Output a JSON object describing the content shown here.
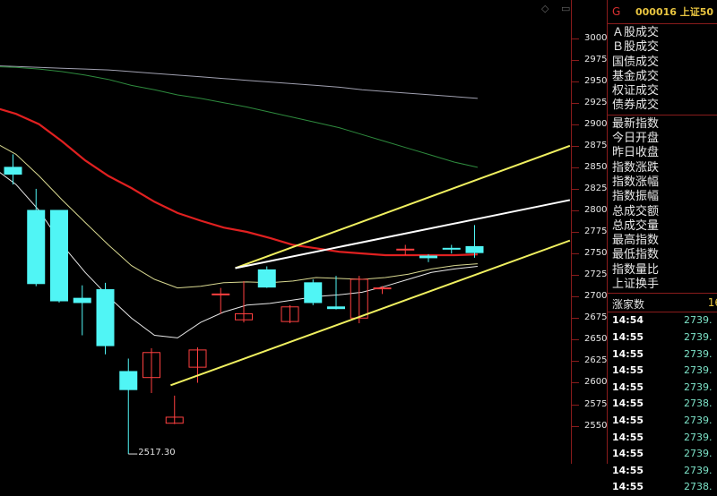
{
  "panel": {
    "market_letter": "G",
    "code_title": "000016 上证50",
    "trade_labels": [
      "Ａ股成交",
      "Ｂ股成交",
      "国债成交",
      "基金成交",
      "权证成交",
      "债券成交"
    ],
    "index_labels": [
      "最新指数",
      "今日开盘",
      "昨日收盘",
      "指数涨跌",
      "指数涨幅",
      "指数振幅",
      "总成交额",
      "总成交量",
      "最高指数",
      "最低指数",
      "指数量比",
      "上证换手"
    ],
    "rise_label": "涨家数",
    "rise_value": "16",
    "ticks": [
      {
        "time": "14:54",
        "price": "2739."
      },
      {
        "time": "14:55",
        "price": "2739."
      },
      {
        "time": "14:55",
        "price": "2739."
      },
      {
        "time": "14:55",
        "price": "2739."
      },
      {
        "time": "14:55",
        "price": "2739."
      },
      {
        "time": "14:55",
        "price": "2738."
      },
      {
        "time": "14:55",
        "price": "2739."
      },
      {
        "time": "14:55",
        "price": "2739."
      },
      {
        "time": "14:55",
        "price": "2739."
      },
      {
        "time": "14:55",
        "price": "2739."
      },
      {
        "time": "14:55",
        "price": "2738."
      }
    ]
  },
  "icons": [
    "dropdown-icon",
    "window-icon"
  ],
  "chart_data": {
    "type": "candlestick",
    "ylim": [
      2530,
      3040
    ],
    "yticks": [
      3000,
      2975,
      2950,
      2925,
      2900,
      2875,
      2850,
      2825,
      2800,
      2775,
      2750,
      2725,
      2700,
      2675,
      2650,
      2625,
      2600,
      2575,
      2550
    ],
    "low_label": "2517.30",
    "colors": {
      "up": "#ff4040",
      "down": "#50f5f5",
      "ma_white": "#e8e8e8",
      "ma_yellow": "#d8d890",
      "ma_red": "#e02020",
      "ma_green": "#2e8b3e",
      "ma_gray": "#a0a0b0",
      "trend_yellow": "#f0f060",
      "trend_white": "#ffffff",
      "axis_red": "#8a1c1c"
    },
    "candles": [
      {
        "open": 2850,
        "high": 2865,
        "low": 2830,
        "close": 2842
      },
      {
        "open": 2800,
        "high": 2825,
        "low": 2712,
        "close": 2715
      },
      {
        "open": 2800,
        "high": 2800,
        "low": 2693,
        "close": 2695
      },
      {
        "open": 2698,
        "high": 2713,
        "low": 2655,
        "close": 2693
      },
      {
        "open": 2708,
        "high": 2716,
        "low": 2633,
        "close": 2643
      },
      {
        "open": 2613,
        "high": 2628,
        "low": 2517.3,
        "close": 2592
      },
      {
        "open": 2606,
        "high": 2640,
        "low": 2588,
        "close": 2635
      },
      {
        "open": 2553,
        "high": 2585,
        "low": 2552,
        "close": 2560
      },
      {
        "open": 2618,
        "high": 2641,
        "low": 2600,
        "close": 2638
      },
      {
        "open": 2703,
        "high": 2710,
        "low": 2680,
        "close": 2703
      },
      {
        "open": 2673,
        "high": 2718,
        "low": 2670,
        "close": 2680
      },
      {
        "open": 2731,
        "high": 2735,
        "low": 2710,
        "close": 2711
      },
      {
        "open": 2671,
        "high": 2690,
        "low": 2669,
        "close": 2688
      },
      {
        "open": 2716,
        "high": 2720,
        "low": 2690,
        "close": 2693
      },
      {
        "open": 2688,
        "high": 2724,
        "low": 2685,
        "close": 2686
      },
      {
        "open": 2675,
        "high": 2724,
        "low": 2669,
        "close": 2720
      },
      {
        "open": 2709,
        "high": 2712,
        "low": 2703,
        "close": 2710
      },
      {
        "open": 2755,
        "high": 2760,
        "low": 2748,
        "close": 2755
      },
      {
        "open": 2747,
        "high": 2749,
        "low": 2740,
        "close": 2745
      },
      {
        "open": 2756,
        "high": 2760,
        "low": 2750,
        "close": 2755
      },
      {
        "open": 2758,
        "high": 2783,
        "low": 2745,
        "close": 2751
      }
    ],
    "moving_averages": [
      {
        "id": "ma-gray",
        "values": [
          2968,
          2967,
          2966,
          2965,
          2964,
          2963,
          2961,
          2959,
          2957,
          2955,
          2953,
          2951,
          2949,
          2947,
          2945,
          2943,
          2940,
          2938,
          2936,
          2934,
          2932,
          2930
        ]
      },
      {
        "id": "ma-green",
        "values": [
          2967,
          2966,
          2964,
          2961,
          2957,
          2952,
          2945,
          2940,
          2934,
          2930,
          2925,
          2920,
          2914,
          2908,
          2902,
          2896,
          2888,
          2880,
          2872,
          2864,
          2856,
          2850
        ]
      },
      {
        "id": "ma-red",
        "values": [
          2920,
          2912,
          2900,
          2880,
          2858,
          2840,
          2826,
          2810,
          2797,
          2788,
          2780,
          2775,
          2768,
          2760,
          2756,
          2752,
          2750,
          2748,
          2748,
          2748,
          2748,
          2749
        ]
      },
      {
        "id": "ma-yellow",
        "values": [
          2880,
          2865,
          2840,
          2812,
          2786,
          2760,
          2736,
          2720,
          2710,
          2712,
          2716,
          2717,
          2716,
          2718,
          2722,
          2721,
          2720,
          2722,
          2726,
          2732,
          2736,
          2738
        ]
      },
      {
        "id": "ma-white",
        "values": [
          2850,
          2830,
          2800,
          2760,
          2728,
          2700,
          2675,
          2655,
          2652,
          2670,
          2682,
          2690,
          2692,
          2696,
          2700,
          2702,
          2705,
          2712,
          2720,
          2728,
          2732,
          2735
        ]
      }
    ],
    "trend_lines": [
      {
        "id": "trend-upper",
        "from": [
          10,
          2733
        ],
        "to": [
          24.5,
          2875
        ]
      },
      {
        "id": "trend-white",
        "from": [
          10,
          2733
        ],
        "to": [
          24.5,
          2812
        ]
      },
      {
        "id": "trend-lower",
        "from": [
          7.2,
          2597
        ],
        "to": [
          24.5,
          2765
        ]
      }
    ]
  }
}
